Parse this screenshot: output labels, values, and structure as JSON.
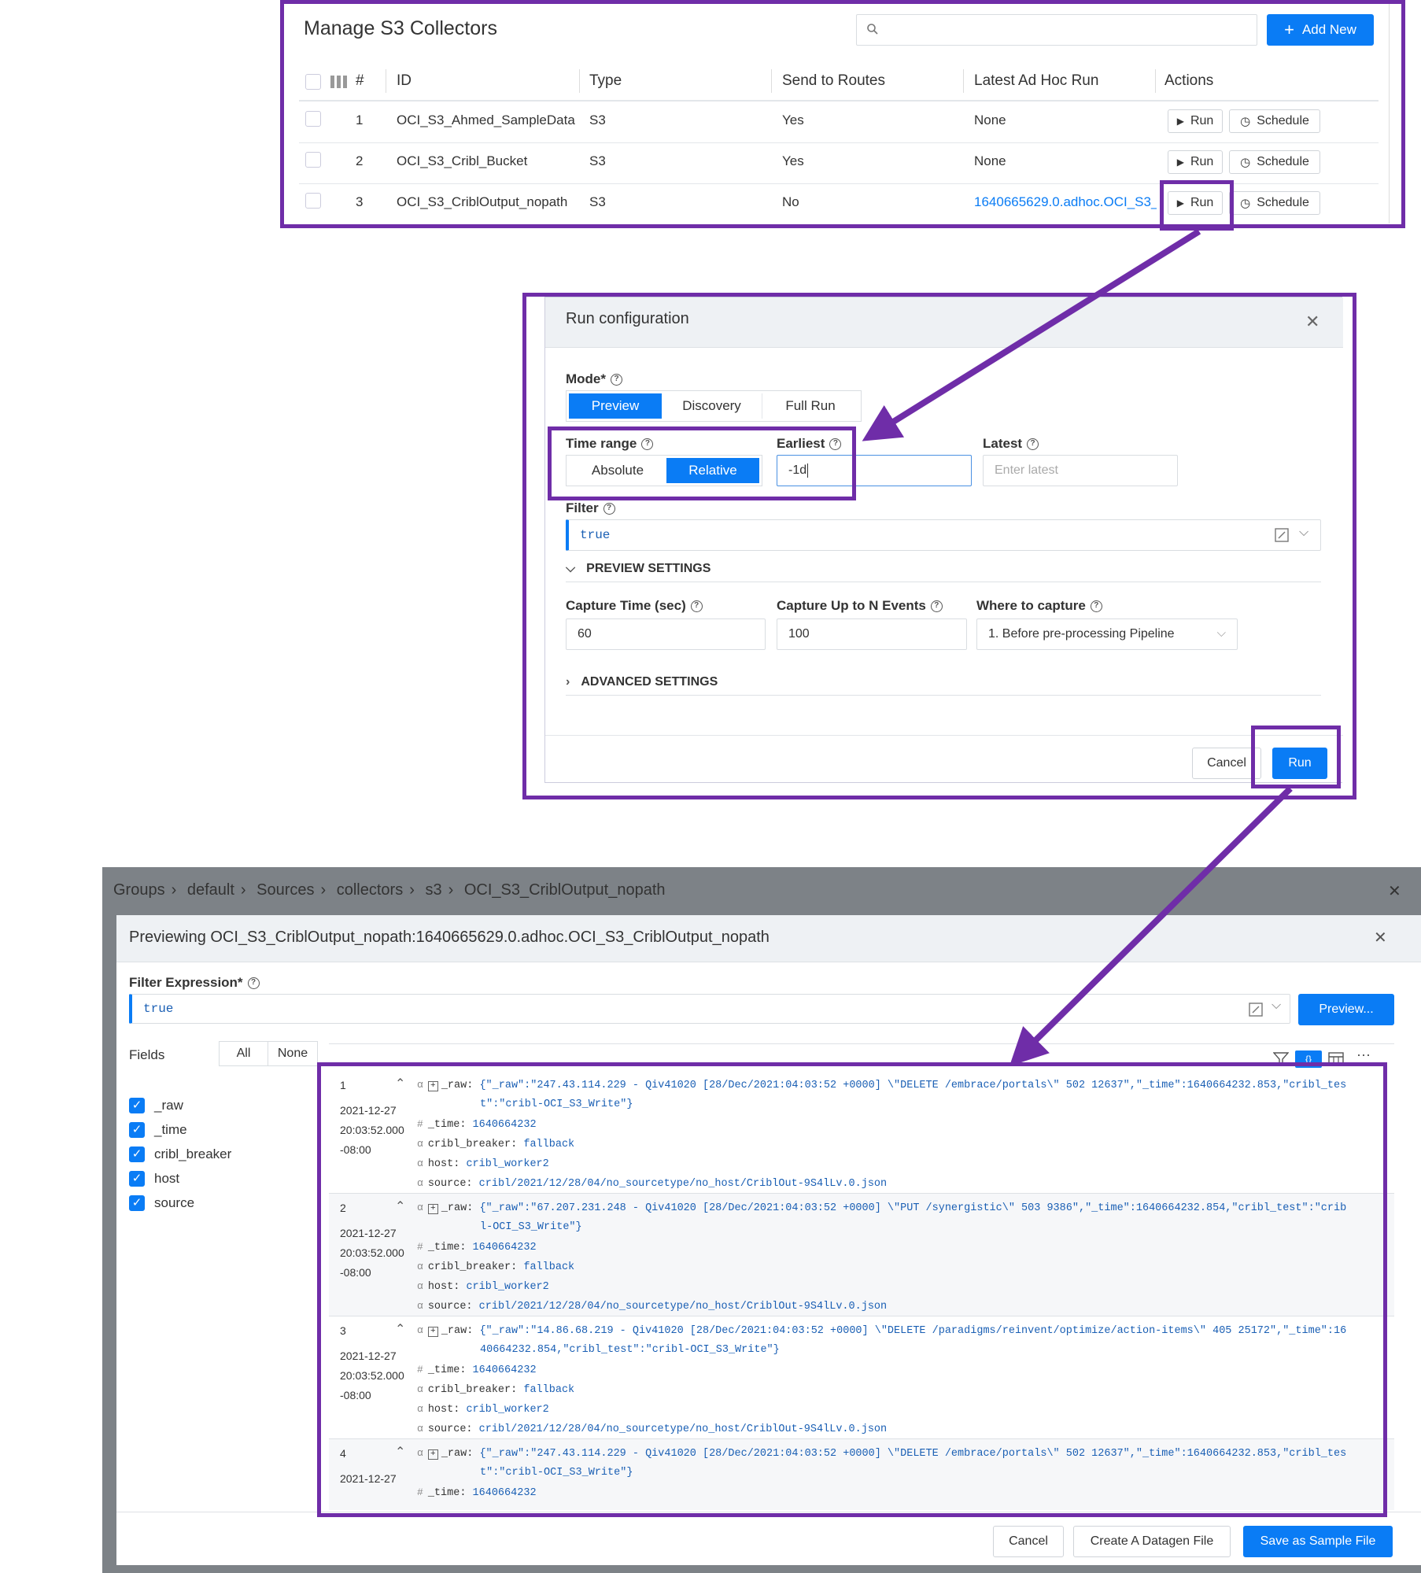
{
  "collectors": {
    "title": "Manage S3 Collectors",
    "search_placeholder": "",
    "add_new_label": "Add New",
    "columns": {
      "num": "#",
      "id": "ID",
      "type": "Type",
      "send": "Send to Routes",
      "latest": "Latest Ad Hoc Run",
      "actions": "Actions"
    },
    "rows": [
      {
        "num": "1",
        "id": "OCI_S3_Ahmed_SampleData",
        "type": "S3",
        "send": "Yes",
        "latest": "None",
        "run": "Run",
        "schedule": "Schedule"
      },
      {
        "num": "2",
        "id": "OCI_S3_Cribl_Bucket",
        "type": "S3",
        "send": "Yes",
        "latest": "None",
        "run": "Run",
        "schedule": "Schedule"
      },
      {
        "num": "3",
        "id": "OCI_S3_CriblOutput_nopath",
        "type": "S3",
        "send": "No",
        "latest": "1640665629.0.adhoc.OCI_S3_(",
        "run": "Run",
        "schedule": "Schedule"
      }
    ]
  },
  "run_config": {
    "title": "Run configuration",
    "mode_label": "Mode*",
    "modes": [
      "Preview",
      "Discovery",
      "Full Run"
    ],
    "active_mode": "Preview",
    "time_range_label": "Time range",
    "time_range_options": [
      "Absolute",
      "Relative"
    ],
    "active_time_range": "Relative",
    "earliest_label": "Earliest",
    "earliest_value": "-1d",
    "latest_label": "Latest",
    "latest_placeholder": "Enter latest",
    "filter_label": "Filter",
    "filter_value": "true",
    "preview_settings_label": "PREVIEW SETTINGS",
    "capture_time_label": "Capture Time (sec)",
    "capture_time_value": "60",
    "capture_events_label": "Capture Up to N Events",
    "capture_events_value": "100",
    "where_label": "Where to capture",
    "where_value": "1. Before pre-processing Pipeline",
    "advanced_label": "ADVANCED SETTINGS",
    "cancel_label": "Cancel",
    "run_label": "Run"
  },
  "preview": {
    "breadcrumb": [
      "Groups",
      "default",
      "Sources",
      "collectors",
      "s3",
      "OCI_S3_CriblOutput_nopath"
    ],
    "title": "Previewing OCI_S3_CriblOutput_nopath:1640665629.0.adhoc.OCI_S3_CriblOutput_nopath",
    "filter_label": "Filter Expression*",
    "filter_value": "true",
    "preview_button": "Preview...",
    "fields_label": "Fields",
    "all_label": "All",
    "none_label": "None",
    "fields": [
      "_raw",
      "_time",
      "cribl_breaker",
      "host",
      "source"
    ],
    "events": [
      {
        "num": "1",
        "date": "2021-12-27",
        "time": "20:03:52.000",
        "tz": "-08:00",
        "raw1": "{\"_raw\":\"247.43.114.229 - Qiv41020 [28/Dec/2021:04:03:52 +0000] \\\"DELETE /embrace/portals\\\" 502 12637\",\"_time\":1640664232.853,\"cribl_tes",
        "raw2": "t\":\"cribl-OCI_S3_Write\"}",
        "time_val": "1640664232",
        "breaker": "fallback",
        "host": "cribl_worker2",
        "source": "cribl/2021/12/28/04/no_sourcetype/no_host/CriblOut-9S4lLv.0.json"
      },
      {
        "num": "2",
        "date": "2021-12-27",
        "time": "20:03:52.000",
        "tz": "-08:00",
        "raw1": "{\"_raw\":\"67.207.231.248 - Qiv41020 [28/Dec/2021:04:03:52 +0000] \\\"PUT /synergistic\\\" 503 9386\",\"_time\":1640664232.854,\"cribl_test\":\"crib",
        "raw2": "l-OCI_S3_Write\"}",
        "time_val": "1640664232",
        "breaker": "fallback",
        "host": "cribl_worker2",
        "source": "cribl/2021/12/28/04/no_sourcetype/no_host/CriblOut-9S4lLv.0.json"
      },
      {
        "num": "3",
        "date": "2021-12-27",
        "time": "20:03:52.000",
        "tz": "-08:00",
        "raw1": "{\"_raw\":\"14.86.68.219 - Qiv41020 [28/Dec/2021:04:03:52 +0000] \\\"DELETE /paradigms/reinvent/optimize/action-items\\\" 405 25172\",\"_time\":16",
        "raw2": "40664232.854,\"cribl_test\":\"cribl-OCI_S3_Write\"}",
        "time_val": "1640664232",
        "breaker": "fallback",
        "host": "cribl_worker2",
        "source": "cribl/2021/12/28/04/no_sourcetype/no_host/CriblOut-9S4lLv.0.json"
      },
      {
        "num": "4",
        "date": "2021-12-27",
        "time": "",
        "tz": "",
        "raw1": "{\"_raw\":\"247.43.114.229 - Qiv41020 [28/Dec/2021:04:03:52 +0000] \\\"DELETE /embrace/portals\\\" 502 12637\",\"_time\":1640664232.853,\"cribl_tes",
        "raw2": "t\":\"cribl-OCI_S3_Write\"}",
        "time_val": "1640664232",
        "breaker": "",
        "host": "",
        "source": ""
      }
    ],
    "keys": {
      "raw": "_raw:",
      "time": "_time:",
      "breaker": "cribl_breaker:",
      "host": "host:",
      "source": "source:"
    },
    "cancel_label": "Cancel",
    "datagen_label": "Create A Datagen File",
    "save_label": "Save as Sample File"
  },
  "colors": {
    "accent": "#0a7cf5",
    "highlight": "#6f2da8",
    "link": "#1a5fb4"
  }
}
